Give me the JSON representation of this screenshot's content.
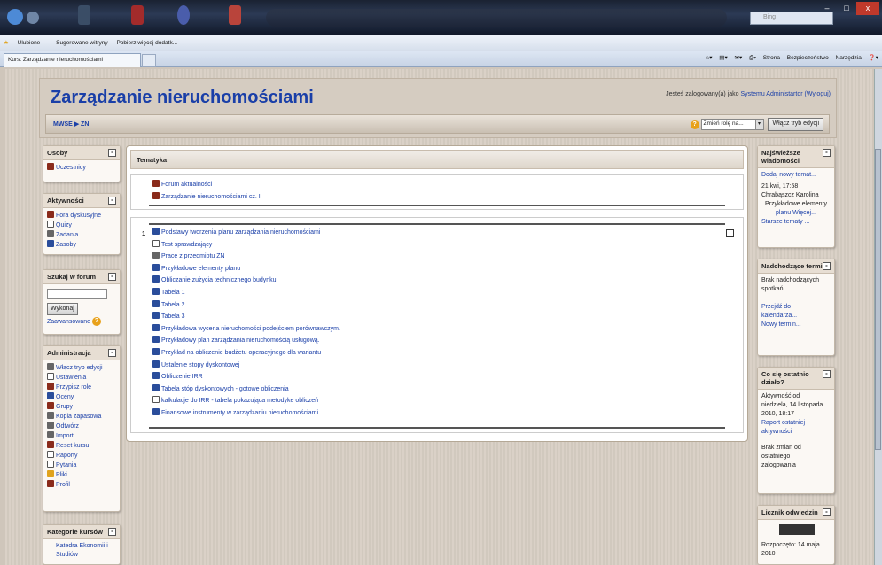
{
  "browser": {
    "search_placeholder": "Bing",
    "favorites_bar": {
      "favorites": "Ulubione",
      "suggested": "Sugerowane witryny",
      "get_more": "Pobierz więcej dodatk..."
    },
    "tab_title": "Kurs: Zarządzanie nieruchomościami",
    "tools": [
      "Strona",
      "Bezpieczeństwo",
      "Narzędzia"
    ]
  },
  "header": {
    "course_title": "Zarządzanie nieruchomościami",
    "login_prefix": "Jesteś zalogowany(a) jako",
    "login_user": "Systemu Administartor",
    "logout": "(Wyloguj)",
    "breadcrumb": "MWSE ▶ ZN",
    "role_select": "Zmień rolę na...",
    "edit_button": "Włącz tryb edycji"
  },
  "left": {
    "people": {
      "title": "Osoby",
      "items": [
        "Uczestnicy"
      ]
    },
    "activities": {
      "title": "Aktywności",
      "items": [
        "Fora dyskusyjne",
        "Quizy",
        "Zadania",
        "Zasoby"
      ]
    },
    "search": {
      "title": "Szukaj w forum",
      "button": "Wykonaj",
      "advanced": "Zaawansowane"
    },
    "admin": {
      "title": "Administracja",
      "items": [
        "Włącz tryb edycji",
        "Ustawienia",
        "Przypisz role",
        "Oceny",
        "Grupy",
        "Kopia zapasowa",
        "Odtwórz",
        "Import",
        "Reset kursu",
        "Raporty",
        "Pytania",
        "Pliki",
        "Profil"
      ]
    },
    "categories": {
      "title": "Kategorie kursów",
      "items": [
        "Katedra Ekonomii i",
        "Studiów"
      ]
    }
  },
  "main": {
    "heading": "Tematyka",
    "topic0": [
      "Forum aktualności",
      "Zarządzanie nieruchomościami cz. II"
    ],
    "topic1_number": "1",
    "topic1": [
      "Podstawy tworzenia planu zarządzania nieruchomościami",
      "Test sprawdzający",
      "Prace z przedmiotu ZN",
      "Przykładowe elementy planu",
      "Obliczanie zużycia technicznego budynku.",
      "Tabela 1",
      "Tabela 2",
      "Tabela 3",
      "Przykładowa wycena nieruchomości podejściem porównawczym.",
      "Przykładowy plan zarządzania nieruchomością usługową.",
      "Przykład na obliczenie budżetu operacyjnego dla wariantu",
      "Ustalenie stopy dyskontowej",
      "Obliczenie IRR",
      "Tabela stóp dyskontowych - gotowe obliczenia",
      "kalkulacje do IRR - tabela pokazująca metodyke obliczeń",
      "Finansowe instrumenty w zarządzaniu nieruchomościami"
    ]
  },
  "right": {
    "news": {
      "title1": "Najświeższe",
      "title2": "wiadomości",
      "add": "Dodaj nowy temat...",
      "date": "21 kwi, 17:58",
      "author": "Chrabąszcz Karolina",
      "post1": "Przykładowe elementy",
      "post2": "planu Więcej...",
      "older": "Starsze tematy ..."
    },
    "events": {
      "title": "Nadchodzące terminy",
      "none1": "Brak nadchodzących",
      "none2": "spotkań",
      "goto1": "Przejdź do",
      "goto2": "kalendarza...",
      "new": "Nowy termin..."
    },
    "recent": {
      "title1": "Co się ostatnio",
      "title2": "działo?",
      "since1": "Aktywność od",
      "since2": "niedziela, 14 listopada",
      "since3": "2010, 18:17",
      "report1": "Raport ostatniej",
      "report2": "aktywności",
      "none1": "Brak zmian od",
      "none2": "ostatniego",
      "none3": "zalogowania"
    },
    "counter": {
      "title": "Licznik odwiedzin",
      "started1": "Rozpoczęto: 14 maja",
      "started2": "2010"
    }
  }
}
